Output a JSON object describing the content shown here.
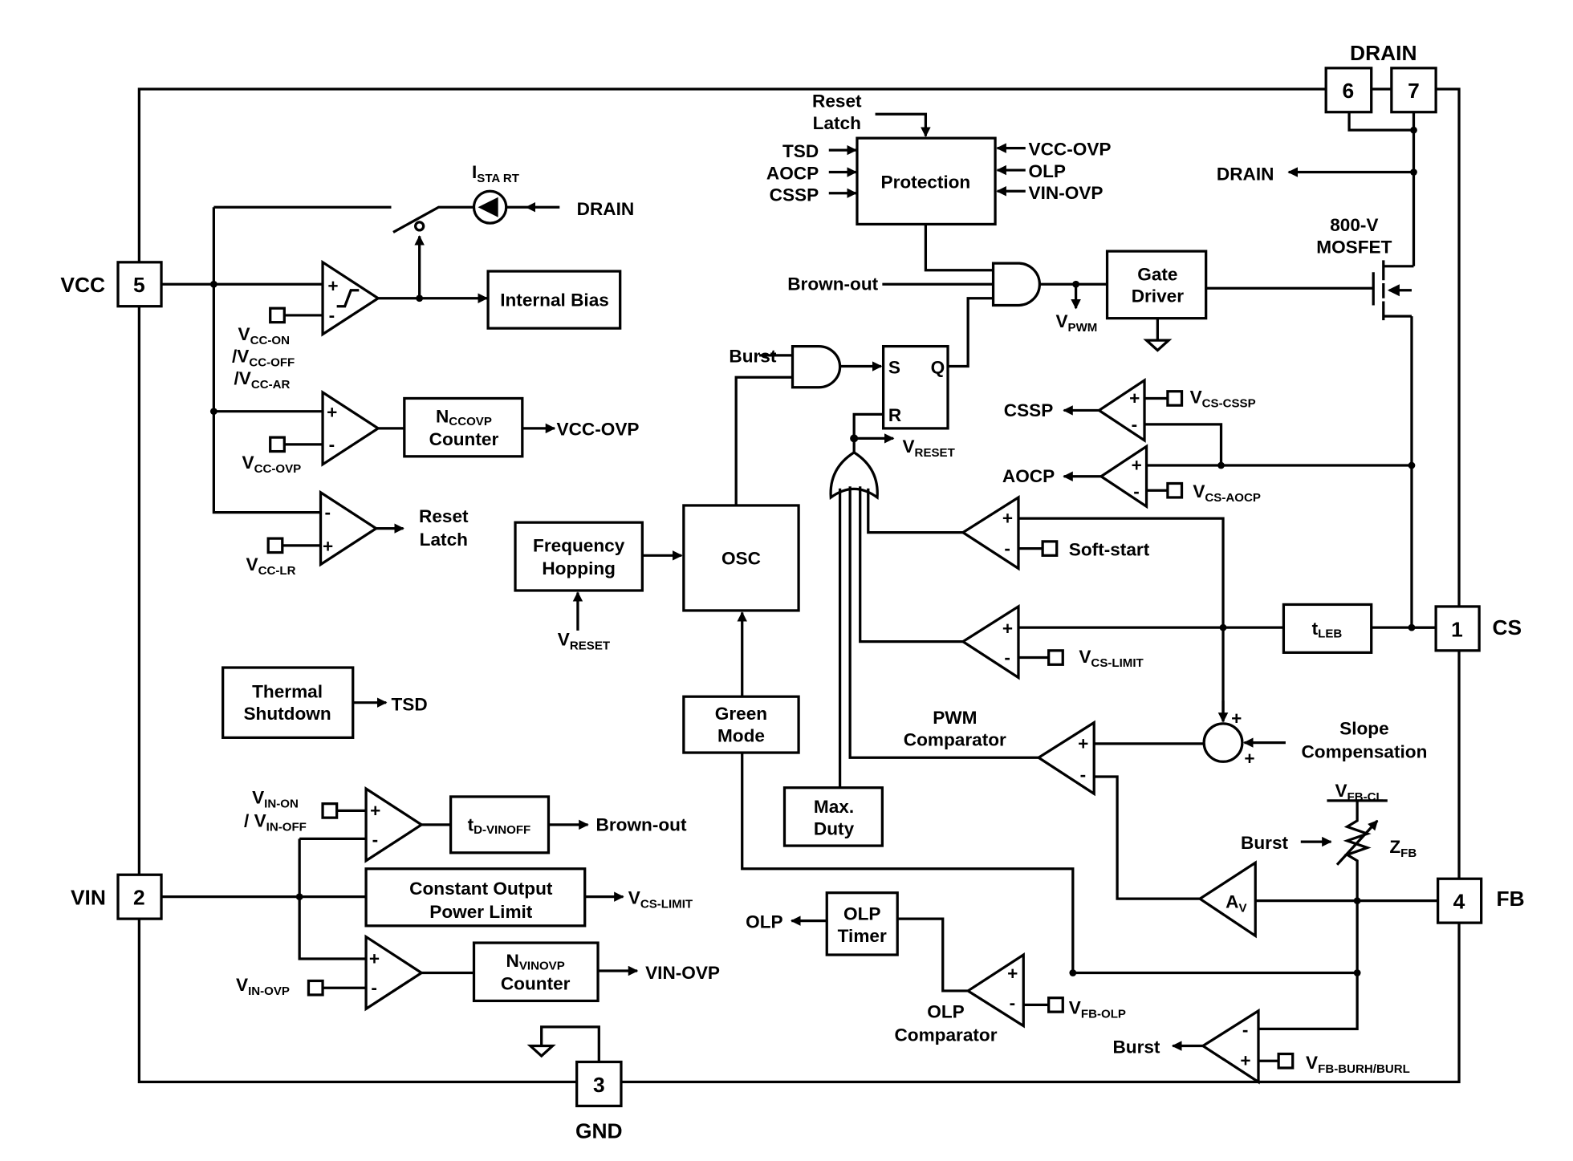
{
  "pins": {
    "vcc": {
      "number": "5",
      "label": "VCC"
    },
    "vin": {
      "number": "2",
      "label": "VIN"
    },
    "gnd": {
      "number": "3",
      "label": "GND"
    },
    "drain6": {
      "number": "6"
    },
    "drain7": {
      "number": "7"
    },
    "drain_label": "DRAIN",
    "cs": {
      "number": "1",
      "label": "CS"
    },
    "fb": {
      "number": "4",
      "label": "FB"
    }
  },
  "blocks": {
    "internal_bias": "Internal Bias",
    "nccovp": {
      "main": "N",
      "sub": "CCOVP",
      "line2": "Counter"
    },
    "freq_hopping": [
      "Frequency",
      "Hopping"
    ],
    "osc": "OSC",
    "thermal_shutdown": [
      "Thermal",
      "Shutdown"
    ],
    "green_mode": [
      "Green",
      "Mode"
    ],
    "td_vinoff": {
      "main": "t",
      "sub": "D-VINOFF"
    },
    "const_power": [
      "Constant Output",
      "Power Limit"
    ],
    "nvinovp": {
      "main": "N",
      "sub": "VINOVP",
      "line2": "Counter"
    },
    "protection": "Protection",
    "gate_driver": [
      "Gate",
      "Driver"
    ],
    "max_duty": [
      "Max.",
      "Duty"
    ],
    "tleb": {
      "main": "t",
      "sub": "LEB"
    },
    "olp_timer": [
      "OLP",
      "Timer"
    ],
    "av": {
      "main": "A",
      "sub": "V"
    },
    "sr": {
      "s": "S",
      "q": "Q",
      "r": "R"
    }
  },
  "labels": {
    "istart": {
      "main": "I",
      "sub": "STA RT"
    },
    "drain_src": "DRAIN",
    "vcc_on": {
      "main": "V",
      "sub": "CC-ON"
    },
    "vcc_off": {
      "main": "/V",
      "sub": "CC-OFF"
    },
    "vcc_ar": {
      "main": "/V",
      "sub": "CC-AR"
    },
    "vcc_ovp_ref": {
      "main": "V",
      "sub": "CC-OVP"
    },
    "vcc_ovp_out": "VCC-OVP",
    "reset_latch_out": [
      "Reset",
      "Latch"
    ],
    "vcc_lr": {
      "main": "V",
      "sub": "CC-LR"
    },
    "vreset_fh": {
      "main": "V",
      "sub": "RESET"
    },
    "tsd_out": "TSD",
    "vin_on": {
      "main": "V",
      "sub": "IN-ON"
    },
    "vin_off": {
      "main": "/ V",
      "sub": "IN-OFF"
    },
    "brownout_out": "Brown-out",
    "vcs_limit_out": {
      "main": "V",
      "sub": "CS-LIMIT"
    },
    "vin_ovp_ref": {
      "main": "V",
      "sub": "IN-OVP"
    },
    "vin_ovp_out": "VIN-OVP",
    "reset_latch_in": [
      "Reset",
      "Latch"
    ],
    "prot_in": [
      "TSD",
      "AOCP",
      "CSSP"
    ],
    "prot_right": [
      "VCC-OVP",
      "OLP",
      "VIN-OVP"
    ],
    "brownout_in": "Brown-out",
    "vpwm": {
      "main": "V",
      "sub": "PWM"
    },
    "mosfet": [
      "800-V",
      "MOSFET"
    ],
    "drain_int": "DRAIN",
    "burst_in": "Burst",
    "vreset": {
      "main": "V",
      "sub": "RESET"
    },
    "cssp": "CSSP",
    "aocp": "AOCP",
    "vcs_cssp": {
      "main": "V",
      "sub": "CS-CSSP"
    },
    "vcs_aocp": {
      "main": "V",
      "sub": "CS-AOCP"
    },
    "soft_start": "Soft-start",
    "vcs_limit": {
      "main": "V",
      "sub": "CS-LIMIT"
    },
    "pwm_comp": [
      "PWM",
      "Comparator"
    ],
    "slope_comp": [
      "Slope",
      "Compensation"
    ],
    "vfb_cl": {
      "main": "V",
      "sub": "FB-CL"
    },
    "burst_zfb": "Burst",
    "zfb": {
      "main": "Z",
      "sub": "FB"
    },
    "olp": "OLP",
    "olp_comp": [
      "OLP",
      "Comparator"
    ],
    "vfb_olp": {
      "main": "V",
      "sub": "FB-OLP"
    },
    "burst_out": "Burst",
    "vfb_burh": {
      "main": "V",
      "sub": "FB-BURH/BURL"
    },
    "plus": "+",
    "minus": "-"
  }
}
